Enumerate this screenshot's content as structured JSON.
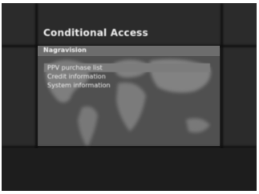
{
  "screen": {
    "title": "Conditional Access"
  },
  "panel": {
    "header": "Nagravision",
    "items": [
      {
        "label": "PPV purchase list",
        "selected": true
      },
      {
        "label": "Credit information",
        "selected": false
      },
      {
        "label": "System information",
        "selected": false
      }
    ]
  },
  "colors": {
    "background": "#2b2b2b",
    "panel_header": "#6d6d6d",
    "highlight": "#7c7c7c",
    "text": "#f0f0f0"
  }
}
